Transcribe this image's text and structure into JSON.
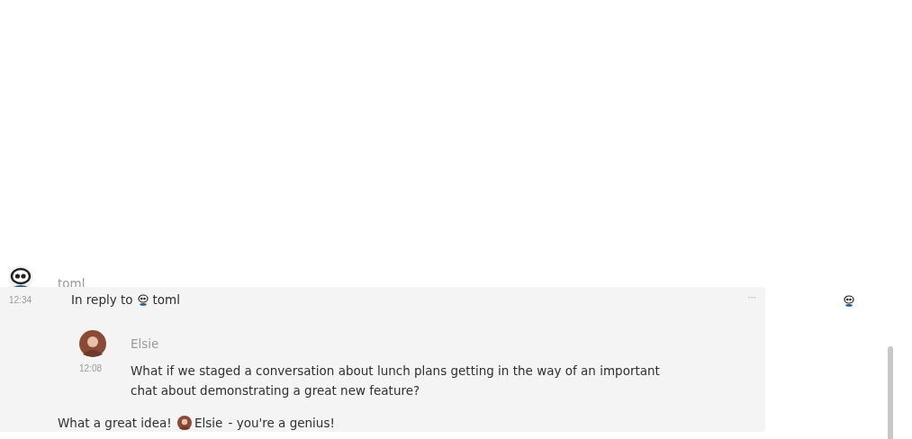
{
  "message": {
    "sender": "toml",
    "time": "12:34",
    "reply_label": "In reply to",
    "reply_to": "toml",
    "menu": "···",
    "quote": {
      "sender": "Elsie",
      "time": "12:08",
      "text": "What if we staged a conversation about lunch plans getting in the way of an important chat about demonstrating a great new feature?"
    },
    "body": [
      {
        "kind": "text",
        "text": "What a great idea! "
      },
      {
        "kind": "mention",
        "text": "Elsie"
      },
      {
        "kind": "text",
        "text": " - you're a genius!"
      }
    ]
  }
}
